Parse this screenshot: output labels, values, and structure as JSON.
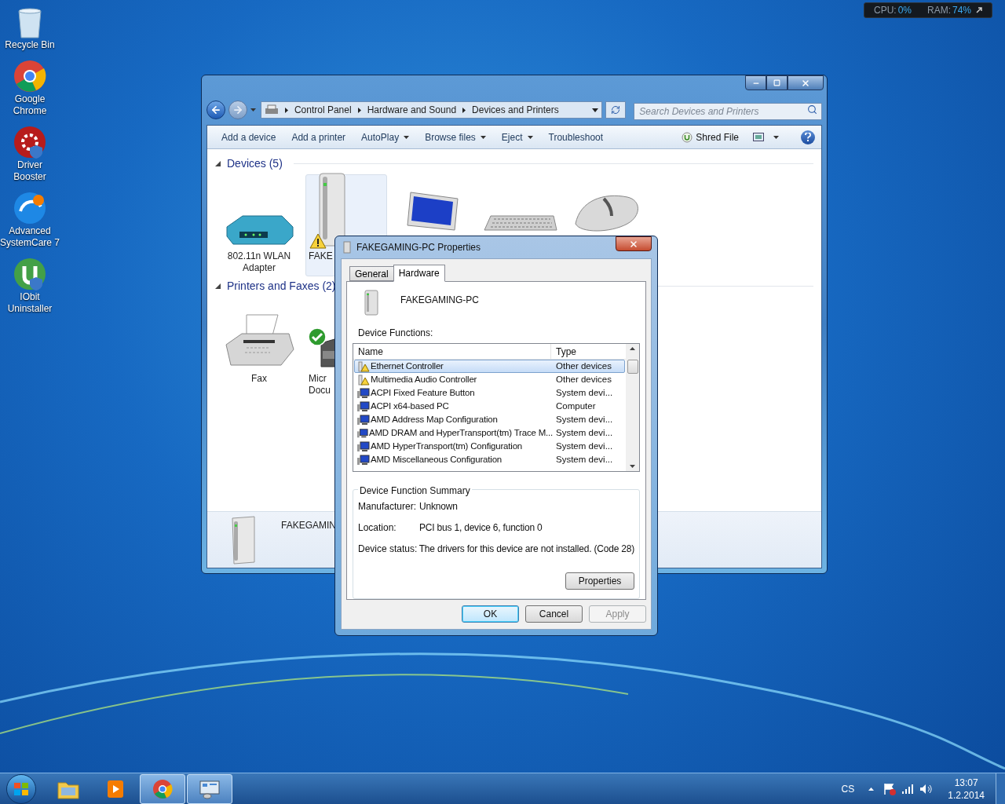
{
  "desktop_icons": [
    {
      "kind": "recycle",
      "lines": [
        "Recycle Bin"
      ]
    },
    {
      "kind": "chrome",
      "lines": [
        "Google",
        "Chrome"
      ]
    },
    {
      "kind": "driver",
      "lines": [
        "Driver",
        "Booster"
      ]
    },
    {
      "kind": "asc",
      "lines": [
        "Advanced",
        "SystemCare 7"
      ]
    },
    {
      "kind": "iobit",
      "lines": [
        "IObit",
        "Uninstaller"
      ]
    }
  ],
  "monitor_widget": {
    "cpu_label": "CPU:",
    "cpu": "0%",
    "ram_label": "RAM:",
    "ram": "74%"
  },
  "explorer": {
    "breadcrumb": [
      "Control Panel",
      "Hardware and Sound",
      "Devices and Printers"
    ],
    "search": {
      "placeholder": "Search Devices and Printers"
    },
    "toolbar": [
      {
        "label": "Add a device",
        "dropdown": false
      },
      {
        "label": "Add a printer",
        "dropdown": false
      },
      {
        "label": "AutoPlay",
        "dropdown": true
      },
      {
        "label": "Browse files",
        "dropdown": true
      },
      {
        "label": "Eject",
        "dropdown": true
      },
      {
        "label": "Troubleshoot",
        "dropdown": false
      }
    ],
    "shred": "Shred File",
    "groups": [
      {
        "title": "Devices (5)",
        "expanded": true,
        "items": [
          {
            "kind": "router",
            "lines": [
              "802.11n WLAN",
              "Adapter"
            ],
            "selected": false,
            "warning": false
          },
          {
            "kind": "pc",
            "lines": [
              "FAKE"
            ],
            "selected": true,
            "warning": true
          },
          {
            "kind": "monitor",
            "selected": false,
            "warning": false
          },
          {
            "kind": "keyboard",
            "selected": false,
            "warning": false
          },
          {
            "kind": "mouse",
            "selected": false,
            "warning": false
          }
        ]
      },
      {
        "title": "Printers and Faxes (2)",
        "expanded": true,
        "items": [
          {
            "kind": "fax",
            "lines": [
              "Fax"
            ],
            "selected": false,
            "default": false
          },
          {
            "kind": "printer",
            "lines": [
              "Micr",
              "Docu"
            ],
            "selected": false,
            "default": true
          }
        ]
      }
    ],
    "details": {
      "name": "FAKEGAMIN"
    }
  },
  "dialog": {
    "title": "FAKEGAMING-PC Properties",
    "tabs": [
      {
        "label": "General",
        "selected": false
      },
      {
        "label": "Hardware",
        "selected": true
      }
    ],
    "device_name": "FAKEGAMING-PC",
    "functions_label": "Device Functions:",
    "columns": [
      "Name",
      "Type"
    ],
    "rows": [
      {
        "kind": "warning",
        "name": "Ethernet Controller",
        "type": "Other devices",
        "selected": true
      },
      {
        "kind": "warning",
        "name": "Multimedia Audio Controller",
        "type": "Other devices",
        "selected": false
      },
      {
        "kind": "system",
        "name": "ACPI Fixed Feature Button",
        "type": "System devi...",
        "selected": false
      },
      {
        "kind": "system",
        "name": "ACPI x64-based PC",
        "type": "Computer",
        "selected": false
      },
      {
        "kind": "system",
        "name": "AMD Address Map Configuration",
        "type": "System devi...",
        "selected": false
      },
      {
        "kind": "system",
        "name": "AMD DRAM and HyperTransport(tm) Trace M...",
        "type": "System devi...",
        "selected": false
      },
      {
        "kind": "system",
        "name": "AMD HyperTransport(tm) Configuration",
        "type": "System devi...",
        "selected": false
      },
      {
        "kind": "system",
        "name": "AMD Miscellaneous Configuration",
        "type": "System devi...",
        "selected": false
      }
    ],
    "summary": {
      "title": "Device Function Summary",
      "fields": [
        {
          "label": "Manufacturer:",
          "value": "Unknown"
        },
        {
          "label": "Location:",
          "value": "PCI bus 1, device 6, function 0"
        },
        {
          "label": "Device status:",
          "value": "The drivers for this device are not installed. (Code 28)"
        }
      ]
    },
    "properties_button": "Properties",
    "buttons": [
      {
        "label": "OK",
        "default": true,
        "disabled": false
      },
      {
        "label": "Cancel",
        "default": false,
        "disabled": false
      },
      {
        "label": "Apply",
        "default": false,
        "disabled": true
      }
    ]
  },
  "taskbar": {
    "items": [
      {
        "kind": "explorer",
        "active": false
      },
      {
        "kind": "media",
        "active": false
      },
      {
        "kind": "chrome",
        "active": true
      },
      {
        "kind": "control",
        "active": true
      }
    ],
    "language": "CS",
    "time": "13:07",
    "date": "1.2.2014"
  }
}
